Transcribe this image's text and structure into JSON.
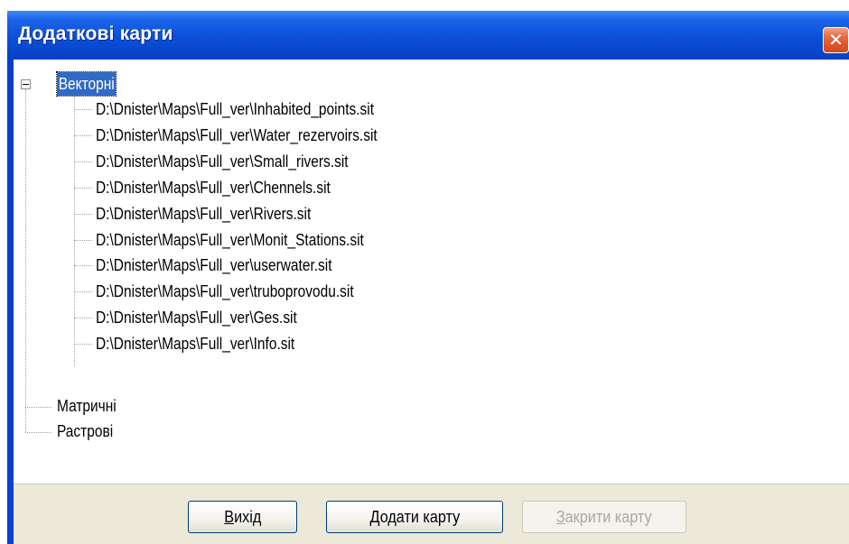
{
  "window": {
    "title": "Додаткові карти",
    "close_glyph": "✕"
  },
  "tree": {
    "root_vector": {
      "label": "Векторні",
      "expanded": true,
      "selected": true,
      "children": [
        "D:\\Dnister\\Maps\\Full_ver\\Inhabited_points.sit",
        "D:\\Dnister\\Maps\\Full_ver\\Water_rezervoirs.sit",
        "D:\\Dnister\\Maps\\Full_ver\\Small_rivers.sit",
        "D:\\Dnister\\Maps\\Full_ver\\Chennels.sit",
        "D:\\Dnister\\Maps\\Full_ver\\Rivers.sit",
        "D:\\Dnister\\Maps\\Full_ver\\Monit_Stations.sit",
        "D:\\Dnister\\Maps\\Full_ver\\userwater.sit",
        "D:\\Dnister\\Maps\\Full_ver\\truboprovodu.sit",
        "D:\\Dnister\\Maps\\Full_ver\\Ges.sit",
        "D:\\Dnister\\Maps\\Full_ver\\Info.sit"
      ]
    },
    "root_matrix": {
      "label": "Матричні"
    },
    "root_raster": {
      "label": "Растрові"
    }
  },
  "buttons": {
    "exit": {
      "accel": "В",
      "rest": "ихід",
      "enabled": true
    },
    "add_map": {
      "accel": "Д",
      "rest": "одати карту",
      "enabled": true
    },
    "close_map": {
      "accel": "З",
      "rest": "акрити карту",
      "enabled": false
    }
  },
  "colors": {
    "title_bar": "#0b4fd8",
    "selection": "#316ac5",
    "close_button": "#e4673f",
    "dialog_face": "#ece9d8"
  }
}
